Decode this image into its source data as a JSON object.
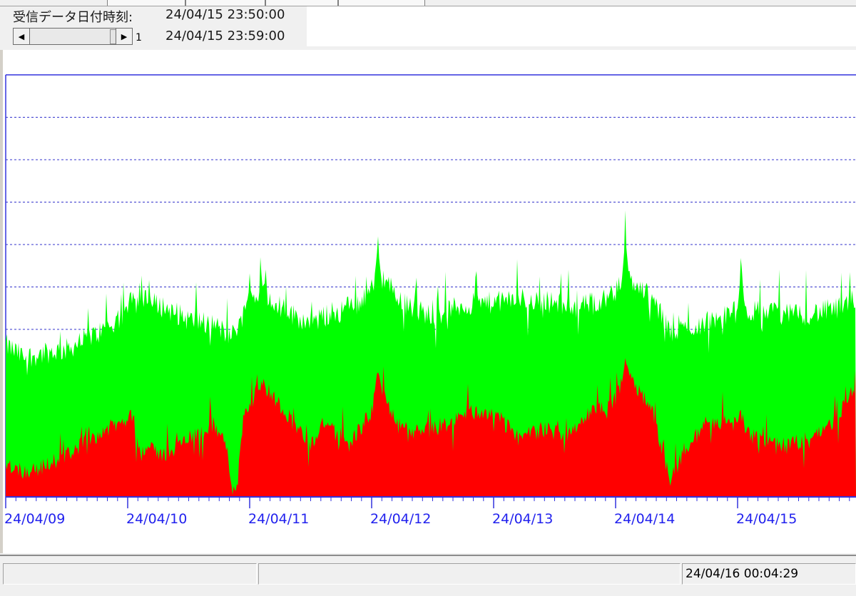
{
  "info": {
    "label": "受信データ日付時刻:",
    "time1": "24/04/15 23:50:00",
    "time2": "24/04/15 23:59:00",
    "scroll_value": "1"
  },
  "icons": {
    "left": "scroll-left-arrow-icon",
    "right": "scroll-right-arrow-icon"
  },
  "chart_data": {
    "type": "area",
    "x_tick_labels": [
      "24/04/09",
      "24/04/10",
      "24/04/11",
      "24/04/12",
      "24/04/13",
      "24/04/14",
      "24/04/15"
    ],
    "grid": "horizontal dashed",
    "series": [
      {
        "color": "#00ff00",
        "day_levels": [
          [
            0.0,
            0.36
          ],
          [
            0.15,
            0.33
          ],
          [
            0.3,
            0.34
          ],
          [
            0.5,
            0.35
          ],
          [
            0.7,
            0.38
          ],
          [
            0.9,
            0.41
          ],
          [
            1.0,
            0.44
          ],
          [
            1.1,
            0.47
          ],
          [
            1.3,
            0.45
          ],
          [
            1.5,
            0.42
          ],
          [
            1.7,
            0.41
          ],
          [
            1.85,
            0.38
          ],
          [
            2.0,
            0.46
          ],
          [
            2.1,
            0.49
          ],
          [
            2.3,
            0.44
          ],
          [
            2.5,
            0.41
          ],
          [
            2.7,
            0.44
          ],
          [
            2.9,
            0.46
          ],
          [
            3.0,
            0.5
          ],
          [
            3.1,
            0.52
          ],
          [
            3.3,
            0.45
          ],
          [
            3.5,
            0.43
          ],
          [
            3.7,
            0.45
          ],
          [
            3.9,
            0.46
          ],
          [
            4.0,
            0.46
          ],
          [
            4.2,
            0.47
          ],
          [
            4.5,
            0.46
          ],
          [
            4.7,
            0.45
          ],
          [
            4.9,
            0.47
          ],
          [
            5.0,
            0.49
          ],
          [
            5.1,
            0.52
          ],
          [
            5.3,
            0.47
          ],
          [
            5.45,
            0.39
          ],
          [
            5.6,
            0.4
          ],
          [
            5.8,
            0.42
          ],
          [
            6.0,
            0.44
          ],
          [
            6.2,
            0.44
          ],
          [
            6.5,
            0.43
          ],
          [
            6.7,
            0.44
          ],
          [
            6.9,
            0.45
          ],
          [
            6.95,
            0.47
          ]
        ],
        "spikes": [
          [
            1.03,
            0.56
          ],
          [
            3.05,
            0.67
          ],
          [
            5.08,
            0.7
          ],
          [
            6.03,
            0.64
          ],
          [
            2.0,
            0.53
          ]
        ]
      },
      {
        "color": "#ff0000",
        "day_levels": [
          [
            0.0,
            0.08
          ],
          [
            0.15,
            0.06
          ],
          [
            0.3,
            0.07
          ],
          [
            0.5,
            0.1
          ],
          [
            0.7,
            0.14
          ],
          [
            0.9,
            0.17
          ],
          [
            1.0,
            0.18
          ],
          [
            1.1,
            0.12
          ],
          [
            1.3,
            0.1
          ],
          [
            1.5,
            0.14
          ],
          [
            1.7,
            0.17
          ],
          [
            1.8,
            0.13
          ],
          [
            1.86,
            0.02
          ],
          [
            1.9,
            0.03
          ],
          [
            1.95,
            0.2
          ],
          [
            2.0,
            0.22
          ],
          [
            2.1,
            0.27
          ],
          [
            2.3,
            0.2
          ],
          [
            2.5,
            0.12
          ],
          [
            2.6,
            0.18
          ],
          [
            2.8,
            0.12
          ],
          [
            3.0,
            0.2
          ],
          [
            3.05,
            0.28
          ],
          [
            3.2,
            0.17
          ],
          [
            3.4,
            0.15
          ],
          [
            3.6,
            0.17
          ],
          [
            3.8,
            0.2
          ],
          [
            4.0,
            0.2
          ],
          [
            4.2,
            0.14
          ],
          [
            4.4,
            0.16
          ],
          [
            4.6,
            0.15
          ],
          [
            4.8,
            0.2
          ],
          [
            5.0,
            0.23
          ],
          [
            5.1,
            0.3
          ],
          [
            5.3,
            0.2
          ],
          [
            5.45,
            0.04
          ],
          [
            5.55,
            0.1
          ],
          [
            5.7,
            0.16
          ],
          [
            5.9,
            0.18
          ],
          [
            6.0,
            0.17
          ],
          [
            6.2,
            0.13
          ],
          [
            6.4,
            0.12
          ],
          [
            6.6,
            0.14
          ],
          [
            6.8,
            0.18
          ],
          [
            6.95,
            0.26
          ]
        ],
        "spikes": [
          [
            1.03,
            0.28
          ],
          [
            3.05,
            0.32
          ],
          [
            5.08,
            0.35
          ],
          [
            6.03,
            0.28
          ]
        ]
      }
    ]
  },
  "status": {
    "datetime": "24/04/16 00:04:29"
  }
}
